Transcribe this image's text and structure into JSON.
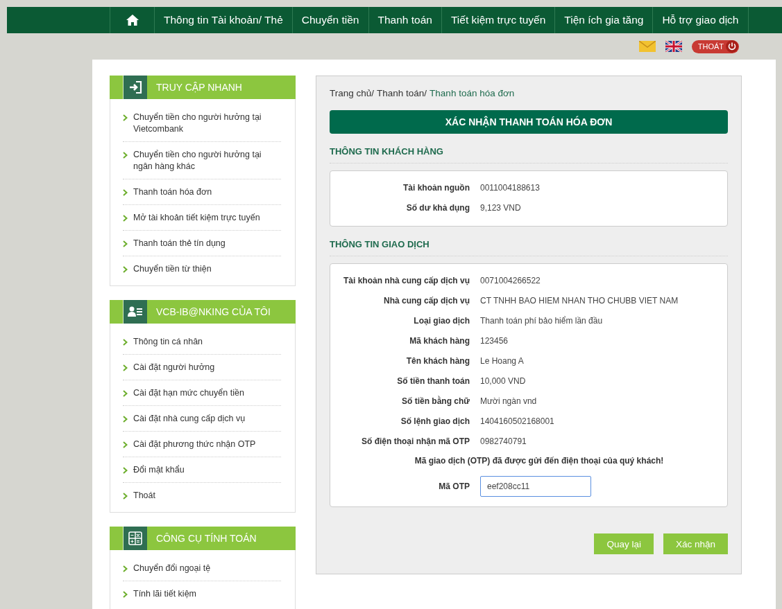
{
  "nav": {
    "items": [
      {
        "kind": "home"
      },
      {
        "kind": "text",
        "label": "Thông tin Tài khoản/ Thẻ"
      },
      {
        "kind": "text",
        "label": "Chuyển tiền"
      },
      {
        "kind": "text",
        "label": "Thanh toán"
      },
      {
        "kind": "text",
        "label": "Tiết kiệm trực tuyến"
      },
      {
        "kind": "text",
        "label": "Tiện ích gia tăng"
      },
      {
        "kind": "text",
        "label": "Hỗ trợ giao dịch"
      }
    ]
  },
  "utility": {
    "logout": "THOÁT"
  },
  "sidebar": [
    {
      "title": "TRUY CẬP NHANH",
      "kind": "login",
      "items": [
        "Chuyển tiền cho người hưởng tại Vietcombank",
        "Chuyển tiền cho người hưởng tại ngân hàng khác",
        "Thanh toán hóa đơn",
        "Mở tài khoản tiết kiệm trực tuyến",
        "Thanh toán thẻ tín dụng",
        "Chuyển tiền từ thiện"
      ]
    },
    {
      "title": "VCB-IB@NKING CỦA TÔI",
      "kind": "profile",
      "items": [
        "Thông tin cá nhân",
        "Cài đặt người hưởng",
        "Cài đặt hạn mức chuyển tiền",
        "Cài đặt nhà cung cấp dịch vụ",
        "Cài đặt phương thức nhận OTP",
        "Đổi mật khẩu",
        "Thoát"
      ]
    },
    {
      "title": "CÔNG CỤ TÍNH TOÁN",
      "kind": "calculator",
      "items": [
        "Chuyển đổi ngoại tệ",
        "Tính lãi tiết kiệm"
      ]
    }
  ],
  "breadcrumb": [
    {
      "label": "Trang chủ/",
      "current": false
    },
    {
      "label": "Thanh toán/",
      "current": false
    },
    {
      "label": "Thanh toán hóa đơn",
      "current": true
    }
  ],
  "title": "XÁC NHẬN THANH TOÁN HÓA ĐƠN",
  "customer": {
    "heading": "THÔNG TIN KHÁCH HÀNG",
    "rows": [
      {
        "label": "Tài khoản nguồn",
        "value": "0011004188613"
      },
      {
        "label": "Số dư khả dụng",
        "value": "9,123 VND"
      }
    ]
  },
  "transaction": {
    "heading": "THÔNG TIN GIAO DỊCH",
    "rows": [
      {
        "label": "Tài khoản nhà cung cấp dịch vụ",
        "value": "0071004266522"
      },
      {
        "label": "Nhà cung cấp dịch vụ",
        "value": "CT TNHH BAO HIEM NHAN THO CHUBB VIET NAM"
      },
      {
        "label": "Loại giao dịch",
        "value": "Thanh toán phí bảo hiểm lần đầu"
      },
      {
        "label": "Mã khách hàng",
        "value": "123456"
      },
      {
        "label": "Tên khách hàng",
        "value": "Le Hoang A"
      },
      {
        "label": "Số tiền thanh toán",
        "value": "10,000 VND"
      },
      {
        "label": "Số tiền bằng chữ",
        "value": "Mười ngàn vnd"
      },
      {
        "label": "Số lệnh giao dịch",
        "value": "1404160502168001"
      },
      {
        "label": "Số điện thoại nhận mã OTP",
        "value": "0982740791"
      }
    ],
    "notice": "Mã giao dịch (OTP) đã được gửi đến điện thoại của quý khách!",
    "otp": {
      "label": "Mã OTP",
      "value": "eef208cc11"
    }
  },
  "buttons": [
    "Quay lại",
    "Xác nhận"
  ]
}
